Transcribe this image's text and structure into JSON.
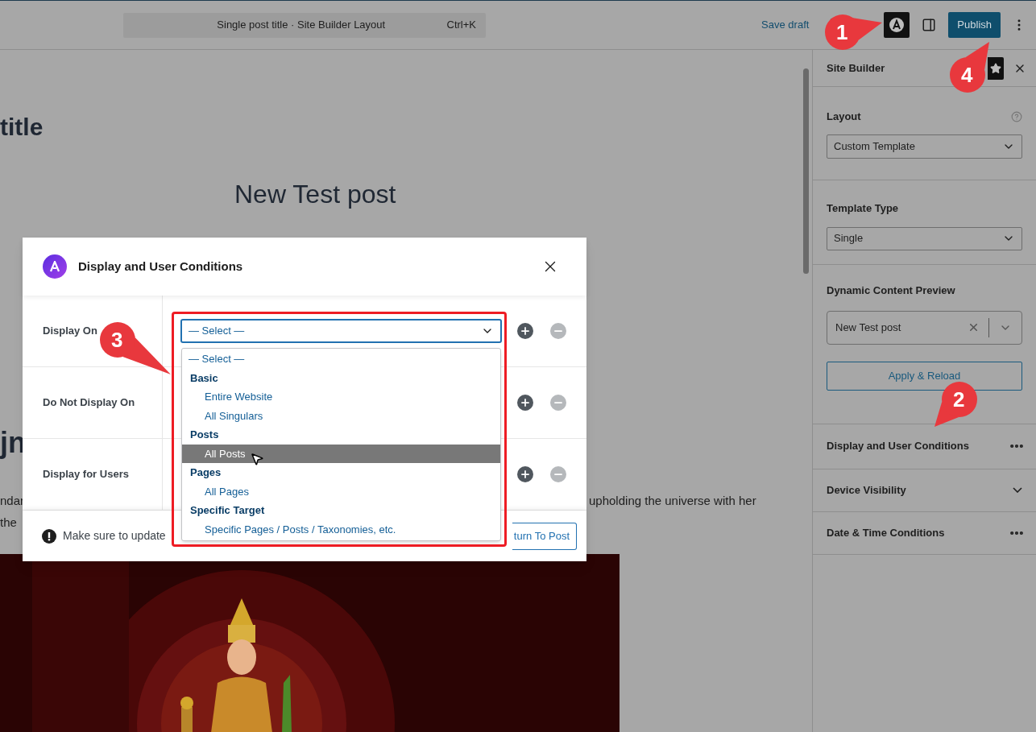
{
  "top_bar": {
    "command_bar": {
      "title": "Single post title · Site Builder Layout",
      "shortcut": "Ctrl+K"
    },
    "save_draft": "Save draft",
    "publish": "Publish"
  },
  "canvas": {
    "heading_fragment": "title",
    "post_title": "New Test post",
    "subheading_fragment": "jn",
    "paragraph": {
      "line_1_left": "ndar",
      "line_1_right": "upholding the universe with her",
      "line_2_left": "the"
    }
  },
  "modal": {
    "title": "Display and User Conditions",
    "rows": [
      {
        "label": "Display On"
      },
      {
        "label": "Do Not Display On"
      },
      {
        "label": "Display for Users"
      }
    ],
    "select": {
      "value": "— Select —"
    },
    "dropdown": [
      {
        "kind": "option",
        "label": "— Select —",
        "selected": false
      },
      {
        "kind": "group",
        "label": "Basic"
      },
      {
        "kind": "option",
        "label": "Entire Website",
        "selected": false
      },
      {
        "kind": "option",
        "label": "All Singulars",
        "selected": false
      },
      {
        "kind": "group",
        "label": "Posts"
      },
      {
        "kind": "option",
        "label": "All Posts",
        "selected": true
      },
      {
        "kind": "group",
        "label": "Pages"
      },
      {
        "kind": "option",
        "label": "All Pages",
        "selected": false
      },
      {
        "kind": "group",
        "label": "Specific Target"
      },
      {
        "kind": "option",
        "label": "Specific Pages / Posts / Taxonomies, etc.",
        "selected": false
      }
    ],
    "footer": {
      "notice": "Make sure to update",
      "button": "turn To Post"
    }
  },
  "sidebar": {
    "title": "Site Builder",
    "layout": {
      "label": "Layout",
      "value": "Custom Template"
    },
    "template_type": {
      "label": "Template Type",
      "value": "Single"
    },
    "preview": {
      "label": "Dynamic Content Preview",
      "value": "New Test post",
      "button": "Apply & Reload"
    },
    "panels": [
      {
        "title": "Display and User Conditions",
        "kind": "menu"
      },
      {
        "title": "Device Visibility",
        "kind": "toggle"
      },
      {
        "title": "Date & Time Conditions",
        "kind": "menu"
      }
    ]
  },
  "annotations": [
    {
      "number": "1"
    },
    {
      "number": "4"
    },
    {
      "number": "2"
    },
    {
      "number": "3"
    }
  ]
}
